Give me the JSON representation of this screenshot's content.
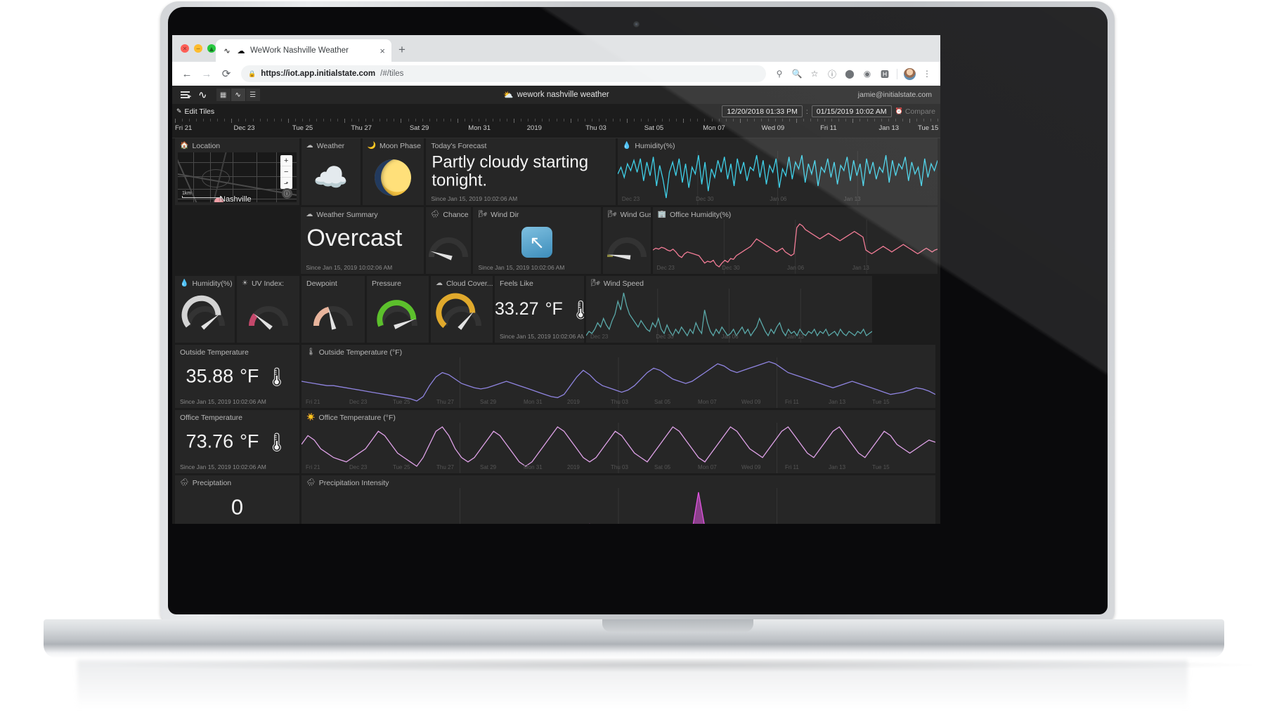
{
  "browser": {
    "tab": {
      "title": "WeWork Nashville Weather",
      "favicon": "wave-icon",
      "site_icon": "cloud-icon",
      "close": "×"
    },
    "new_tab": "+",
    "nav": {
      "back": "←",
      "forward": "→",
      "reload": "⟳"
    },
    "omnibox": {
      "lock": "🔒",
      "host": "https://iot.app.initialstate.com",
      "path": "/#/tiles"
    },
    "toolbar_icons": [
      "key-icon",
      "zoom-out-icon",
      "star-icon",
      "info-circle-icon",
      "extension-gray-icon",
      "extension-circle-icon",
      "grammarly-icon"
    ],
    "menu": "⋮"
  },
  "app": {
    "title": "wework nashville weather",
    "title_icon": "cloud-icon",
    "user": "jamie@initialstate.com",
    "view_tabs": [
      {
        "name": "tiles-view",
        "glyph": "▦",
        "active": true
      },
      {
        "name": "waves-view",
        "glyph": "⌇",
        "active": false
      },
      {
        "name": "lines-view",
        "glyph": "☰",
        "active": false
      }
    ],
    "edit_tiles": "Edit Tiles",
    "range": {
      "start": "12/20/2018 01:33 PM",
      "separator": ":",
      "end": "01/15/2019 10:02 AM",
      "compare": "Compare"
    }
  },
  "ruler": {
    "labels": [
      "Fri 21",
      "Dec 23",
      "Tue 25",
      "Thu 27",
      "Sat 29",
      "Mon 31",
      "2019",
      "Thu 03",
      "Sat 05",
      "Mon 07",
      "Wed 09",
      "Fri 11",
      "Jan 13",
      "Tue 15"
    ]
  },
  "since_text": "Since Jan 15, 2019 10:02:06 AM",
  "tiles": {
    "location": {
      "label": "Location",
      "icon": "house-icon",
      "city": "Nashville",
      "scale": "1km",
      "zoom_in": "+",
      "zoom_out": "−",
      "compass": "⬏"
    },
    "weather": {
      "label": "Weather",
      "icon": "cloud-icon",
      "art": "cloud-art"
    },
    "moon_phase": {
      "label": "Moon Phase",
      "icon": "moon-icon",
      "art": "moon-art"
    },
    "todays_forecast": {
      "label": "Today's Forecast",
      "value": "Partly cloudy starting tonight."
    },
    "humidity_graph": {
      "label": "Humidity(%)",
      "icon": "droplet-icon",
      "color": "#3fd0e8",
      "axis": [
        "Dec 23",
        "Dec 30",
        "Jan 06",
        "Jan 13"
      ]
    },
    "weather_summary": {
      "label": "Weather Summary",
      "icon": "cloud-icon",
      "value": "Overcast"
    },
    "chance": {
      "label": "Chance (%)",
      "icon": "rain-icon",
      "gauge_pct": 10,
      "arc_color": "#3a3a3a"
    },
    "wind_dir": {
      "label": "Wind Dir",
      "icon": "wind-icon",
      "art": "arrow-up-left-icon"
    },
    "wind_gust": {
      "label": "Wind Gust",
      "icon": "wind-icon",
      "gauge_pct": 4,
      "arc_color": "#8d8a3f"
    },
    "office_humidity": {
      "label": "Office Humidity(%)",
      "icon": "office-icon",
      "color": "#f07b95",
      "axis": [
        "Dec 23",
        "Dec 30",
        "Jan 06",
        "Jan 13"
      ]
    },
    "humidity_gauge": {
      "label": "Humidity(%)",
      "icon": "droplet-icon",
      "gauge_pct": 78,
      "arc_color": "#d4d4d4"
    },
    "uv_index": {
      "label": "UV Index:",
      "icon": "sun-icon",
      "gauge_pct": 22,
      "arc_color": "#c4486b"
    },
    "dewpoint": {
      "label": "Dewpoint",
      "gauge_pct": 42,
      "arc_color": "#e8b49c"
    },
    "pressure": {
      "label": "Pressure",
      "gauge_pct": 88,
      "arc_color": "#5cc02c"
    },
    "cloud_cover": {
      "label": "Cloud Cover...",
      "icon": "cloud-icon",
      "gauge_pct": 72,
      "arc_color": "#e0a92c"
    },
    "feels_like": {
      "label": "Feels Like",
      "value": "33.27",
      "unit": "°F",
      "icon": "thermometer-icon"
    },
    "wind_speed": {
      "label": "Wind Speed",
      "icon": "wind-icon",
      "color": "#5aa8a8",
      "axis": [
        "Dec 23",
        "Dec 30",
        "Jan 06",
        "Jan 13"
      ]
    },
    "outside_temperature": {
      "label": "Outside Temperature",
      "value": "35.88",
      "unit": "°F",
      "icon": "thermometer-icon"
    },
    "outside_temperature_graph": {
      "label": "Outside Temperature (°F)",
      "icon": "thermometer-icon",
      "color": "#8f84e0"
    },
    "office_temperature": {
      "label": "Office Temperature",
      "value": "73.76",
      "unit": "°F",
      "icon": "thermometer-icon"
    },
    "office_temperature_graph": {
      "label": "Office Temperature (°F)",
      "icon": "sun-icon",
      "color": "#dfa2e8"
    },
    "precipitation": {
      "label": "Preciptation",
      "icon": "rain-icon",
      "value": "0"
    },
    "precipitation_intensity": {
      "label": "Precipitation Intensity",
      "icon": "rain-icon",
      "color": "#e055e0"
    }
  },
  "chart_data": {
    "type": "line",
    "series": [
      {
        "name": "Humidity(%)",
        "color": "#3fd0e8",
        "values": [
          72,
          80,
          68,
          84,
          76,
          88,
          74,
          90,
          64,
          86,
          70,
          92,
          58,
          82,
          66,
          44,
          74,
          86,
          70,
          90,
          62,
          84,
          56,
          80,
          72,
          94,
          60,
          86,
          52,
          78,
          68,
          88,
          74,
          92,
          66,
          84,
          58,
          90,
          72,
          86,
          64,
          80,
          76,
          94,
          68,
          88,
          60,
          82,
          74,
          90,
          56,
          78,
          70,
          92,
          66,
          86,
          78,
          94,
          62,
          84,
          72,
          88,
          58,
          80,
          74,
          90,
          68,
          86,
          60,
          82,
          76,
          92,
          64,
          88,
          70,
          84,
          58,
          90,
          72,
          86,
          66,
          80,
          74,
          94,
          62,
          88,
          70,
          84,
          78,
          92,
          64,
          86,
          72,
          80,
          58,
          90,
          68,
          84,
          76,
          88
        ]
      },
      {
        "name": "Office Humidity(%)",
        "color": "#f07b95",
        "values": [
          44,
          46,
          45,
          47,
          46,
          44,
          43,
          45,
          42,
          38,
          36,
          40,
          42,
          41,
          40,
          39,
          38,
          34,
          30,
          32,
          31,
          33,
          28,
          26,
          30,
          33,
          31,
          35,
          34,
          38,
          40,
          42,
          44,
          46,
          48,
          52,
          56,
          54,
          52,
          50,
          48,
          46,
          44,
          42,
          44,
          46,
          42,
          40,
          38,
          40,
          68,
          72,
          70,
          66,
          64,
          62,
          60,
          58,
          56,
          58,
          60,
          62,
          60,
          58,
          56,
          54,
          56,
          58,
          60,
          62,
          64,
          62,
          60,
          58,
          44,
          42,
          40,
          42,
          44,
          46,
          48,
          46,
          44,
          42,
          44,
          46,
          48,
          50,
          48,
          46,
          44,
          42,
          40,
          42,
          44,
          46,
          44,
          42,
          44,
          45
        ]
      },
      {
        "name": "Wind Speed",
        "color": "#5aa8a8",
        "values": [
          6,
          8,
          7,
          9,
          12,
          10,
          14,
          11,
          9,
          13,
          16,
          22,
          18,
          26,
          20,
          16,
          14,
          12,
          10,
          13,
          11,
          9,
          8,
          12,
          10,
          14,
          9,
          7,
          11,
          8,
          6,
          9,
          7,
          10,
          8,
          6,
          9,
          7,
          12,
          9,
          7,
          18,
          12,
          8,
          6,
          9,
          7,
          10,
          8,
          6,
          7,
          9,
          6,
          8,
          10,
          7,
          9,
          6,
          8,
          10,
          14,
          11,
          8,
          6,
          9,
          7,
          10,
          12,
          8,
          6,
          9,
          7,
          8,
          6,
          9,
          7,
          6,
          8,
          7,
          9,
          6,
          8,
          7,
          9,
          6,
          7,
          8,
          6,
          9,
          7,
          6,
          8,
          7,
          6,
          8,
          7,
          9,
          6,
          7,
          8
        ]
      },
      {
        "name": "Outside Temperature (°F)",
        "color": "#8f84e0",
        "values": [
          48,
          47,
          46,
          45,
          44,
          44,
          43,
          42,
          41,
          40,
          39,
          38,
          37,
          36,
          35,
          34,
          33,
          32,
          30,
          34,
          44,
          52,
          56,
          54,
          50,
          46,
          44,
          42,
          41,
          42,
          44,
          46,
          48,
          46,
          44,
          42,
          40,
          38,
          36,
          34,
          33,
          36,
          44,
          52,
          58,
          54,
          48,
          44,
          42,
          40,
          38,
          40,
          44,
          50,
          56,
          60,
          58,
          54,
          50,
          48,
          46,
          48,
          52,
          56,
          60,
          64,
          62,
          58,
          56,
          58,
          60,
          62,
          64,
          66,
          64,
          60,
          56,
          54,
          52,
          50,
          48,
          46,
          44,
          42,
          44,
          46,
          48,
          46,
          44,
          42,
          40,
          38,
          36,
          37,
          38,
          40,
          42,
          41,
          39,
          36
        ]
      },
      {
        "name": "Office Temperature (°F)",
        "color": "#dfa2e8",
        "values": [
          72,
          76,
          74,
          70,
          68,
          66,
          65,
          64,
          66,
          68,
          70,
          74,
          78,
          76,
          72,
          68,
          66,
          64,
          62,
          66,
          72,
          78,
          80,
          76,
          70,
          66,
          64,
          66,
          70,
          74,
          78,
          76,
          72,
          68,
          64,
          62,
          64,
          68,
          72,
          76,
          80,
          78,
          74,
          70,
          66,
          64,
          66,
          70,
          74,
          78,
          76,
          72,
          68,
          66,
          64,
          68,
          72,
          76,
          80,
          78,
          74,
          70,
          66,
          64,
          68,
          72,
          76,
          80,
          78,
          74,
          70,
          68,
          66,
          70,
          74,
          78,
          80,
          76,
          72,
          68,
          66,
          70,
          74,
          78,
          80,
          76,
          72,
          68,
          66,
          70,
          74,
          78,
          76,
          72,
          70,
          68,
          70,
          72,
          74,
          73
        ]
      },
      {
        "name": "Precipitation Intensity",
        "color": "#e055e0",
        "values": [
          0,
          2,
          6,
          1,
          0,
          0,
          3,
          1,
          0,
          0,
          0,
          0,
          0,
          1,
          0,
          0,
          0,
          0,
          0,
          0,
          0,
          0,
          0,
          0,
          0,
          0,
          1,
          0,
          0,
          0,
          0,
          0,
          0,
          0,
          0,
          0,
          0,
          0,
          0,
          0,
          0,
          0,
          0,
          0,
          0,
          18,
          2,
          0,
          0,
          0,
          0,
          0,
          0,
          0,
          0,
          0,
          0,
          0,
          0,
          8,
          4,
          2,
          96,
          10,
          4,
          1,
          0,
          0,
          0,
          0,
          0,
          0,
          0,
          0,
          0,
          0,
          0,
          0,
          0,
          0,
          0,
          0,
          0,
          0,
          0,
          0,
          0,
          0,
          0,
          0,
          0,
          0,
          0,
          3,
          6,
          2,
          0,
          0,
          1,
          0
        ]
      }
    ],
    "xlabel": "",
    "ylabel": "",
    "grid": true
  }
}
